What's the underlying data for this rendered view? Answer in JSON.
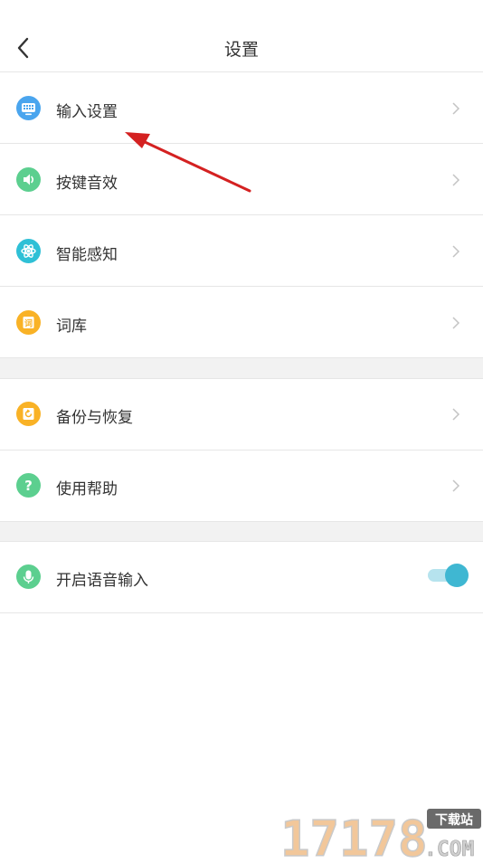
{
  "header": {
    "title": "设置",
    "back_icon": "chevron-left-icon"
  },
  "colors": {
    "blue": "#4aa5ee",
    "green": "#5ccf8f",
    "teal": "#2fc0d6",
    "orange": "#f9b226",
    "divider": "#e6e6e6",
    "gap": "#f2f2f2",
    "toggle_track": "#b6e3ee",
    "toggle_knob": "#3fb7d2",
    "annotation_arrow": "#d42121"
  },
  "groups": [
    {
      "items": [
        {
          "label": "输入设置",
          "icon": "keyboard-icon"
        },
        {
          "label": "按键音效",
          "icon": "speaker-icon"
        },
        {
          "label": "智能感知",
          "icon": "atom-icon"
        },
        {
          "label": "词库",
          "icon": "dictionary-icon",
          "icon_glyph": "词"
        }
      ]
    },
    {
      "items": [
        {
          "label": "备份与恢复",
          "icon": "backup-restore-icon"
        },
        {
          "label": "使用帮助",
          "icon": "help-icon",
          "icon_glyph": "?"
        }
      ]
    },
    {
      "items": [
        {
          "label": "开启语音输入",
          "icon": "microphone-icon",
          "toggle_on": true
        }
      ]
    }
  ],
  "watermark": {
    "text": "17178",
    "tag": "下载站",
    "suffix": ".COM"
  }
}
